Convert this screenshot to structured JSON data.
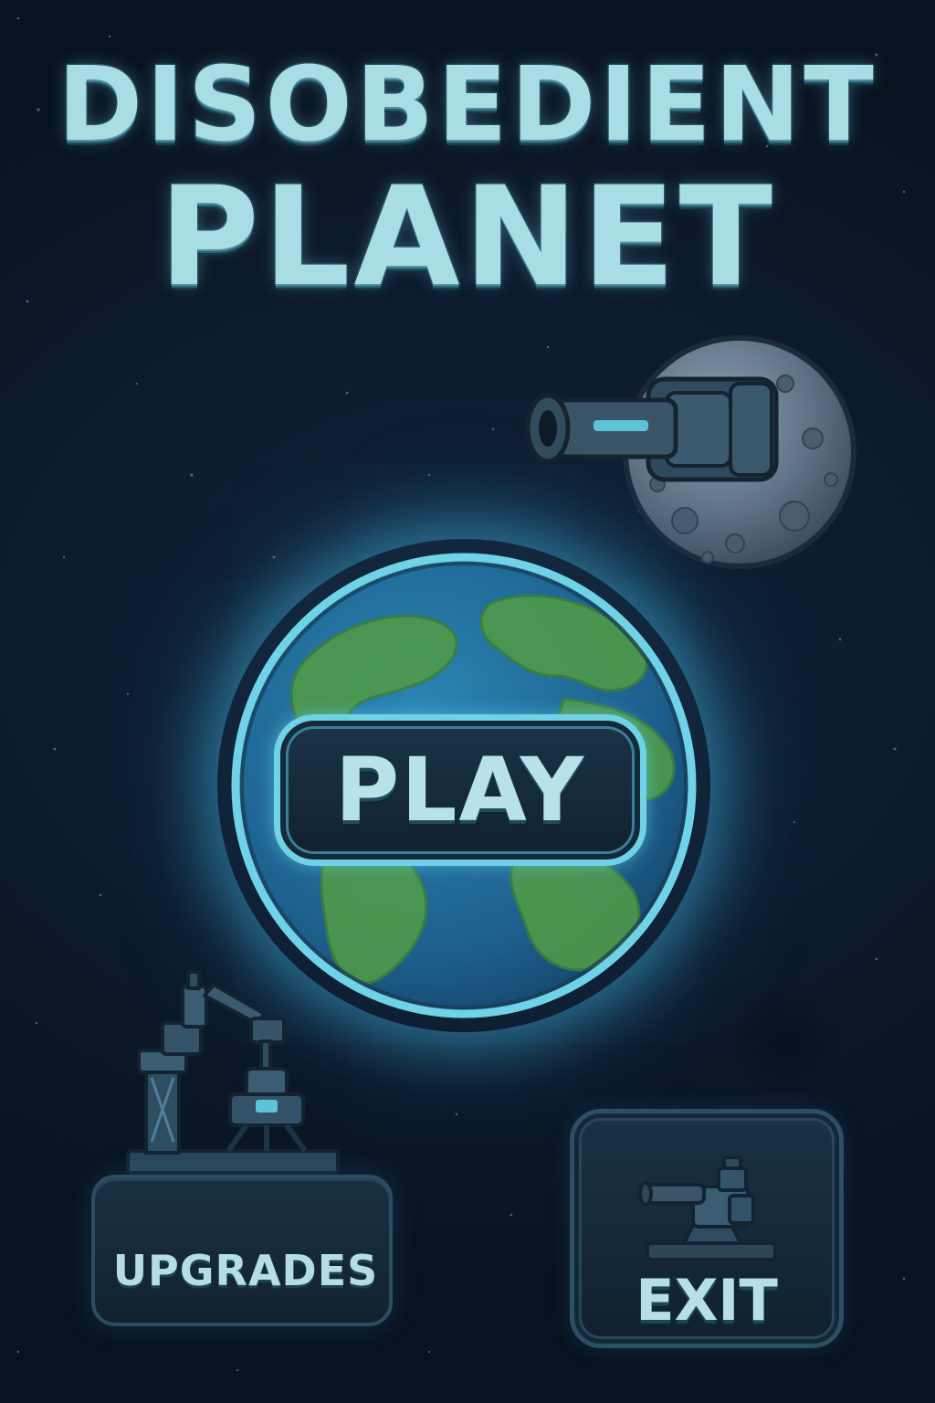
{
  "title": {
    "line1": "DISOBEDIENT",
    "line2": "PLANET"
  },
  "menu": {
    "play_label": "PLAY",
    "upgrades_label": "UPGRADES",
    "exit_label": "EXIT"
  },
  "icons": {
    "moon": "moon-cannon-icon",
    "earth": "earth-planet-icon",
    "upgrades": "robot-factory-icon",
    "exit": "turret-icon"
  },
  "colors": {
    "background": "#0d1b2d",
    "accent_glow": "#6fd2e6",
    "title_text": "#a9dde4",
    "button_fill": "#152a3a",
    "ocean": "#1f6a9a",
    "land": "#4f9a4a"
  }
}
